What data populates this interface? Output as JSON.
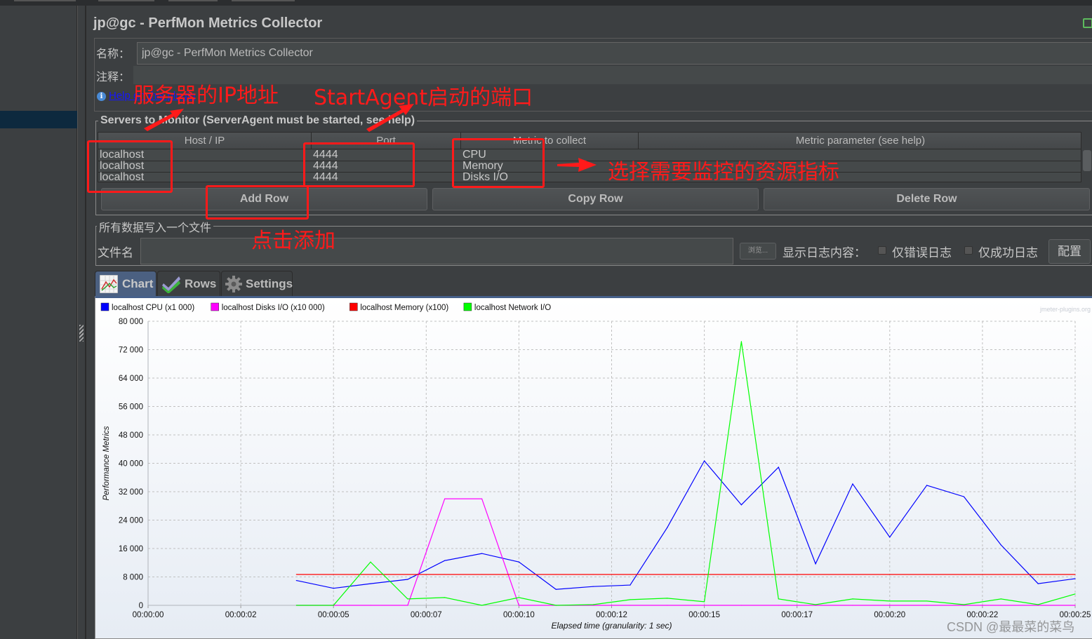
{
  "window": {
    "title": "jp@gc - PerfMon Metrics Collector"
  },
  "form": {
    "name_label": "名称：",
    "name_value": "jp@gc - PerfMon Metrics Collector",
    "comment_label": "注释：",
    "comment_value": "",
    "help_link": "Help on this plugin"
  },
  "servers": {
    "legend": "Servers to Monitor (ServerAgent must be started, see help)",
    "columns": [
      "Host / IP",
      "Port",
      "Metric to collect",
      "Metric parameter (see help)"
    ],
    "rows": [
      {
        "host": "localhost",
        "port": "4444",
        "metric": "CPU",
        "param": ""
      },
      {
        "host": "localhost",
        "port": "4444",
        "metric": "Memory",
        "param": ""
      },
      {
        "host": "localhost",
        "port": "4444",
        "metric": "Disks I/O",
        "param": ""
      }
    ],
    "add_row": "Add Row",
    "copy_row": "Copy Row",
    "delete_row": "Delete Row"
  },
  "file": {
    "legend": "所有数据写入一个文件",
    "filename_label": "文件名",
    "filename_value": "",
    "browse": "浏览...",
    "log_label": "显示日志内容：",
    "errors_only": "仅错误日志",
    "errors_only_checked": false,
    "success_only": "仅成功日志",
    "success_only_checked": false,
    "config": "配置"
  },
  "tabs": [
    {
      "label": "Chart",
      "icon": "chart-icon",
      "active": true
    },
    {
      "label": "Rows",
      "icon": "checkmark-icon",
      "active": false
    },
    {
      "label": "Settings",
      "icon": "gear-icon",
      "active": false
    }
  ],
  "annotations": {
    "server_ip": "服务器的IP地址",
    "agent_port": "StartAgent启动的端口",
    "choose_metric": "选择需要监控的资源指标",
    "click_add": "点击添加"
  },
  "watermark": "CSDN @最最菜的菜鸟",
  "chart_data": {
    "type": "line",
    "title": "",
    "brand": "jmeter-plugins.org",
    "xlabel": "Elapsed time (granularity: 1 sec)",
    "ylabel": "Performance Metrics",
    "xlim": [
      0,
      25
    ],
    "ylim": [
      0,
      80000
    ],
    "grid": true,
    "legend_position": "top-left",
    "x_tick_labels": [
      "00:00:00",
      "00:00:02",
      "00:00:05",
      "00:00:07",
      "00:00:10",
      "00:00:12",
      "00:00:15",
      "00:00:17",
      "00:00:20",
      "00:00:22",
      "00:00:25"
    ],
    "x_tick_values": [
      0,
      2.5,
      5,
      7.5,
      10,
      12.5,
      15,
      17.5,
      20,
      22.5,
      25
    ],
    "y_tick_labels": [
      "0",
      "8 000",
      "16 000",
      "24 000",
      "32 000",
      "40 000",
      "48 000",
      "56 000",
      "64 000",
      "72 000",
      "80 000"
    ],
    "y_tick_values": [
      0,
      8000,
      16000,
      24000,
      32000,
      40000,
      48000,
      56000,
      64000,
      72000,
      80000
    ],
    "x": [
      4,
      5,
      6,
      7,
      8,
      9,
      10,
      11,
      12,
      13,
      14,
      15,
      16,
      17,
      18,
      19,
      20,
      21,
      22,
      23,
      24,
      25
    ],
    "series": [
      {
        "name": "localhost CPU (x1 000)",
        "color": "#0000ff",
        "values": [
          7000,
          4800,
          6100,
          7300,
          12600,
          14600,
          12200,
          4500,
          5300,
          5700,
          21900,
          40700,
          28300,
          38900,
          11700,
          34200,
          19200,
          33800,
          30600,
          17000,
          6100,
          7500
        ]
      },
      {
        "name": "localhost Disks I/O (x10 000)",
        "color": "#ff00ff",
        "values": [
          0,
          0,
          0,
          0,
          30000,
          30000,
          0,
          0,
          0,
          0,
          0,
          0,
          0,
          0,
          0,
          0,
          0,
          0,
          0,
          0,
          0,
          0
        ]
      },
      {
        "name": "localhost Memory (x100)",
        "color": "#ff0000",
        "values": [
          8700,
          8700,
          8700,
          8700,
          8700,
          8700,
          8700,
          8700,
          8700,
          8700,
          8700,
          8700,
          8700,
          8700,
          8700,
          8700,
          8700,
          8700,
          8700,
          8700,
          8700,
          8700
        ]
      },
      {
        "name": "localhost Network I/O",
        "color": "#00ff00",
        "values": [
          0,
          0,
          12200,
          1800,
          2200,
          0,
          2200,
          0,
          200,
          1600,
          2000,
          1000,
          74300,
          1800,
          200,
          1800,
          1200,
          1200,
          200,
          1800,
          200,
          3200
        ]
      }
    ]
  }
}
